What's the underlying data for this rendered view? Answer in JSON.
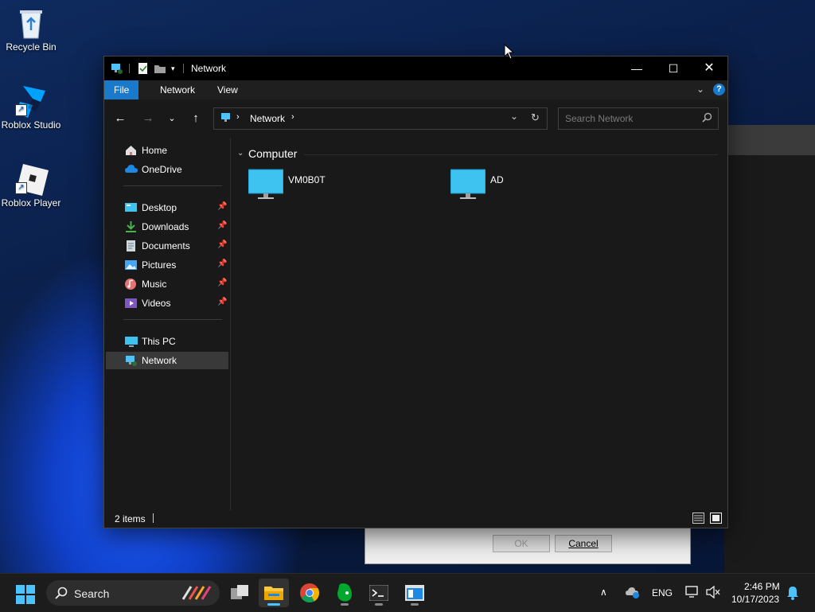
{
  "desktop": {
    "icons": [
      {
        "label": "Recycle Bin"
      },
      {
        "label": "Roblox Studio"
      },
      {
        "label": "Roblox Player"
      }
    ]
  },
  "background_dialog": {
    "ok_label": "OK",
    "cancel_label": "Cancel"
  },
  "explorer": {
    "title": "Network",
    "ribbon_tabs": [
      "File",
      "Network",
      "View"
    ],
    "address": {
      "crumb": "Network"
    },
    "search": {
      "placeholder": "Search Network"
    },
    "nav": {
      "quick": [
        {
          "label": "Home"
        },
        {
          "label": "OneDrive"
        }
      ],
      "pinned": [
        {
          "label": "Desktop"
        },
        {
          "label": "Downloads"
        },
        {
          "label": "Documents"
        },
        {
          "label": "Pictures"
        },
        {
          "label": "Music"
        },
        {
          "label": "Videos"
        }
      ],
      "locations": [
        {
          "label": "This PC"
        },
        {
          "label": "Network",
          "selected": true
        }
      ]
    },
    "group": {
      "label": "Computer"
    },
    "items": [
      {
        "label": "VM0B0T"
      },
      {
        "label": "AD"
      }
    ],
    "status": {
      "count": "2 items"
    }
  },
  "taskbar": {
    "search_label": "Search",
    "language": "ENG",
    "time": "2:46 PM",
    "date": "10/17/2023"
  },
  "colors": {
    "accent": "#1979ca",
    "window_bg": "#191919",
    "titlebar_bg": "#000000",
    "selection": "#393939",
    "monitor": "#3ec3f0"
  }
}
